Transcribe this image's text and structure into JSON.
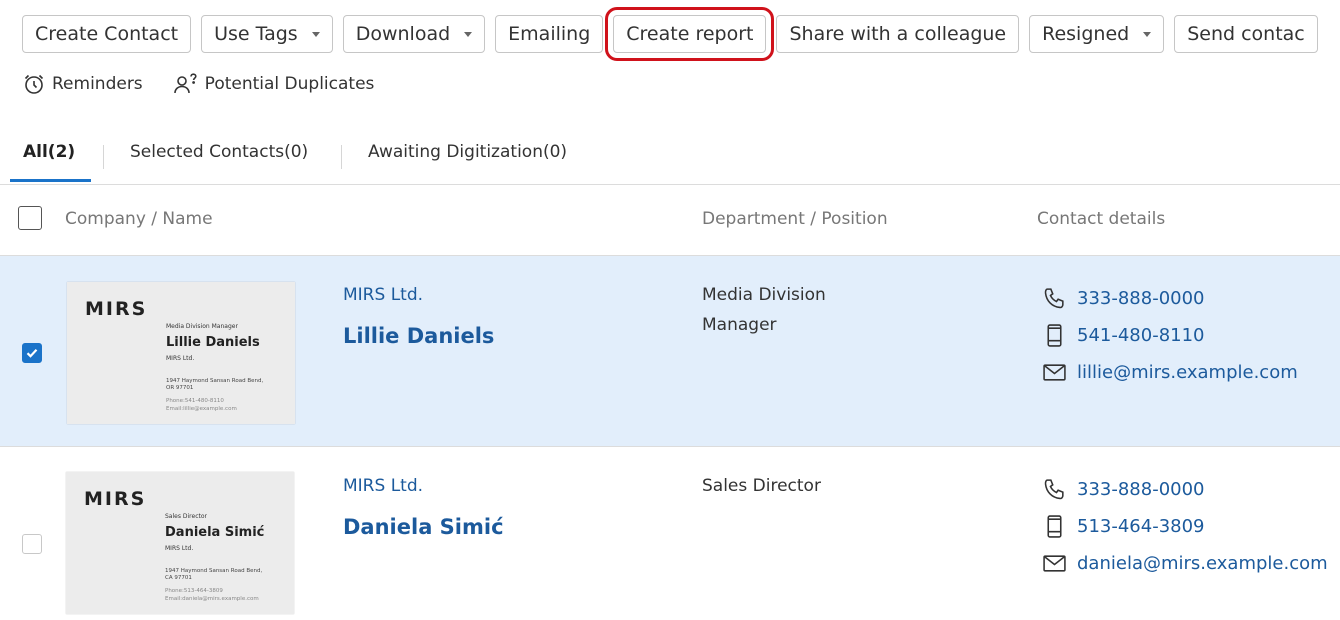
{
  "toolbar": {
    "create_contact": "Create Contact",
    "use_tags": "Use Tags",
    "download": "Download",
    "emailing": "Emailing",
    "create_report": "Create report",
    "share": "Share with a colleague",
    "resigned": "Resigned",
    "send_contact": "Send contac"
  },
  "subtools": {
    "reminders": "Reminders",
    "duplicates": "Potential Duplicates"
  },
  "tabs": {
    "all": "All(2)",
    "selected": "Selected Contacts(0)",
    "awaiting": "Awaiting Digitization(0)"
  },
  "columns": {
    "name": "Company / Name",
    "department": "Department / Position",
    "contact": "Contact details"
  },
  "contacts": [
    {
      "company": "MIRS Ltd.",
      "name": "Lillie Daniels",
      "department": "Media Division",
      "position": "Manager",
      "phone": "333-888-0000",
      "mobile": "541-480-8110",
      "email": "lillie@mirs.example.com",
      "card": {
        "logo": "MIRS",
        "title": "Media Division Manager",
        "name": "Lillie Daniels",
        "company": "MIRS Ltd.",
        "address_1": "1947 Haymond Sansan Road Bend,",
        "address_2": "OR 97701",
        "phone": "Phone:541-480-8110",
        "email": "Email:lillie@example.com"
      }
    },
    {
      "company": "MIRS Ltd.",
      "name": "Daniela Simić",
      "department": "Sales Director",
      "position": "",
      "phone": "333-888-0000",
      "mobile": "513-464-3809",
      "email": "daniela@mirs.example.com",
      "card": {
        "logo": "MIRS",
        "title": "Sales Director",
        "name": "Daniela Simić",
        "company": "MIRS Ltd.",
        "address_1": "1947 Haymond Sansan Road Bend,",
        "address_2": "CA 97701",
        "phone": "Phone:513-464-3809",
        "email": "Email:daniela@mirs.example.com"
      }
    }
  ],
  "colors": {
    "accent": "#1a73c9",
    "link": "#1c5a9c",
    "selected_row": "#e2eefb",
    "highlight": "#d0121b"
  }
}
